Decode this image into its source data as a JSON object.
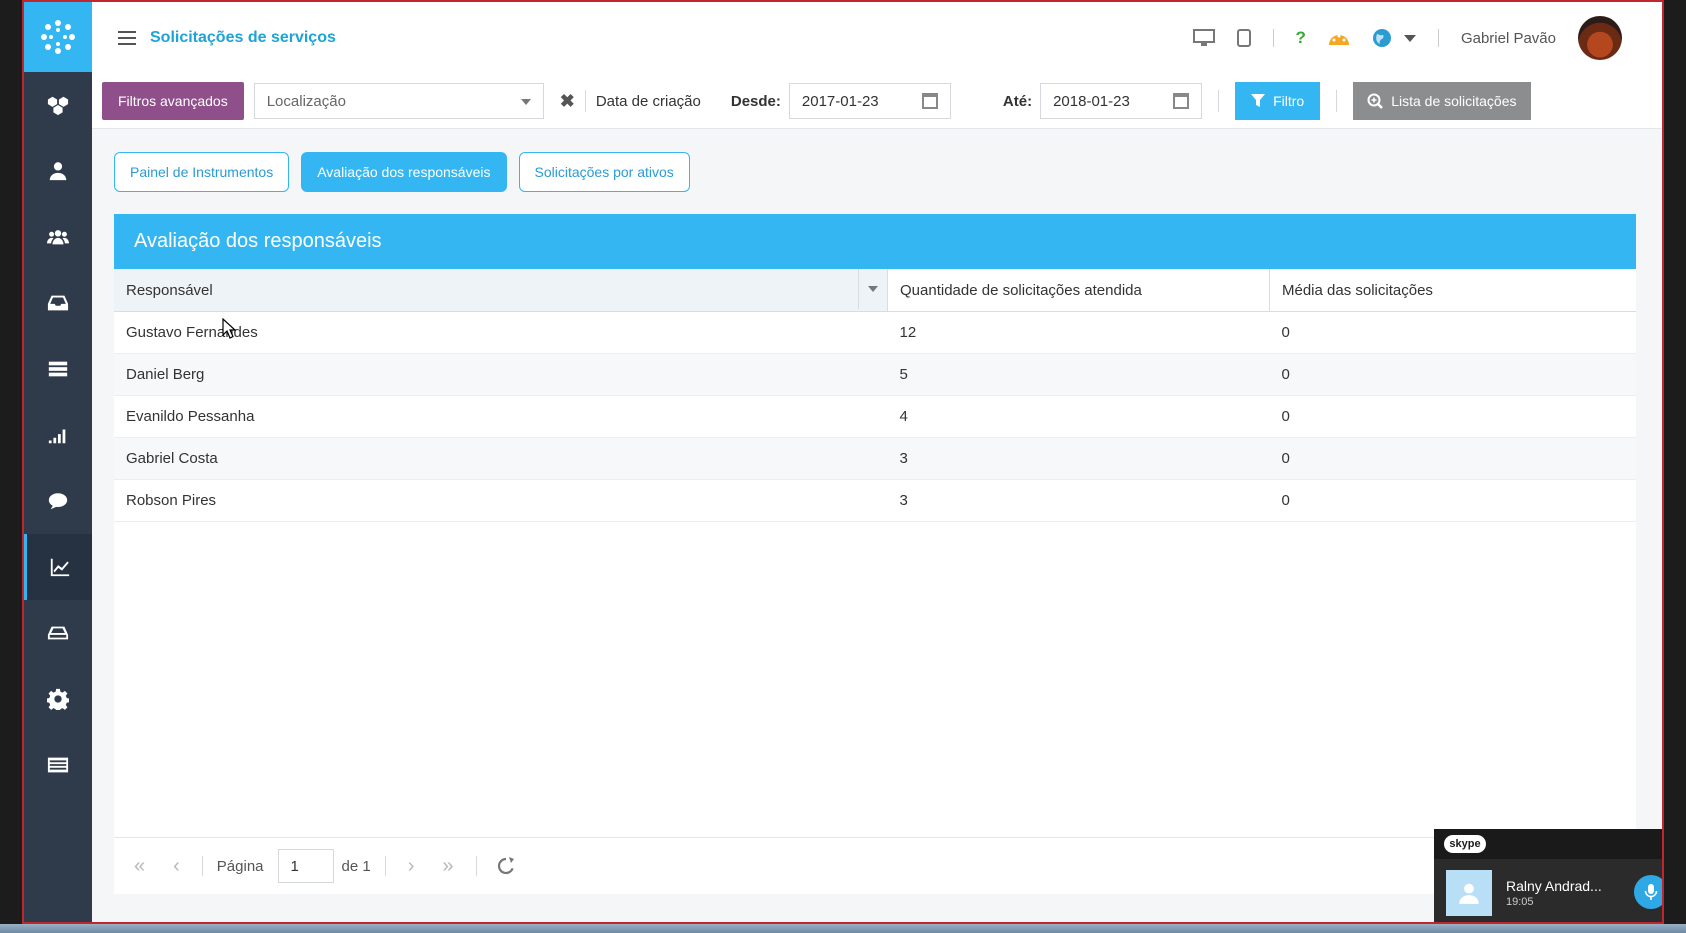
{
  "header": {
    "title": "Solicitações de serviços",
    "user_name": "Gabriel Pavão",
    "help_icon": "?"
  },
  "filters": {
    "advanced_label": "Filtros avançados",
    "location_placeholder": "Localização",
    "created_label": "Data de criação",
    "from_label": "Desde:",
    "from_value": "2017-01-23",
    "to_label": "Até:",
    "to_value": "2018-01-23",
    "filter_button": "Filtro",
    "list_button": "Lista de solicitações"
  },
  "tabs": [
    {
      "label": "Painel de Instrumentos",
      "active": false
    },
    {
      "label": "Avaliação dos responsáveis",
      "active": true
    },
    {
      "label": "Solicitações por ativos",
      "active": false
    }
  ],
  "panel": {
    "title": "Avaliação dos responsáveis",
    "columns": [
      "Responsável",
      "Quantidade de solicitações atendida",
      "Média das solicitações"
    ],
    "rows": [
      [
        "Gustavo Fernandes",
        "12",
        "0"
      ],
      [
        "Daniel Berg",
        "5",
        "0"
      ],
      [
        "Evanildo Pessanha",
        "4",
        "0"
      ],
      [
        "Gabriel Costa",
        "3",
        "0"
      ],
      [
        "Robson Pires",
        "3",
        "0"
      ]
    ]
  },
  "pager": {
    "page_label": "Página",
    "page_value": "1",
    "of_label": "de 1"
  },
  "skype": {
    "logo": "skype",
    "contact": "Ralny Andrad...",
    "time": "19:05"
  },
  "colors": {
    "accent": "#34b6f2",
    "sidebar": "#2f3b4b",
    "advanced_button": "#8e4f8b"
  }
}
